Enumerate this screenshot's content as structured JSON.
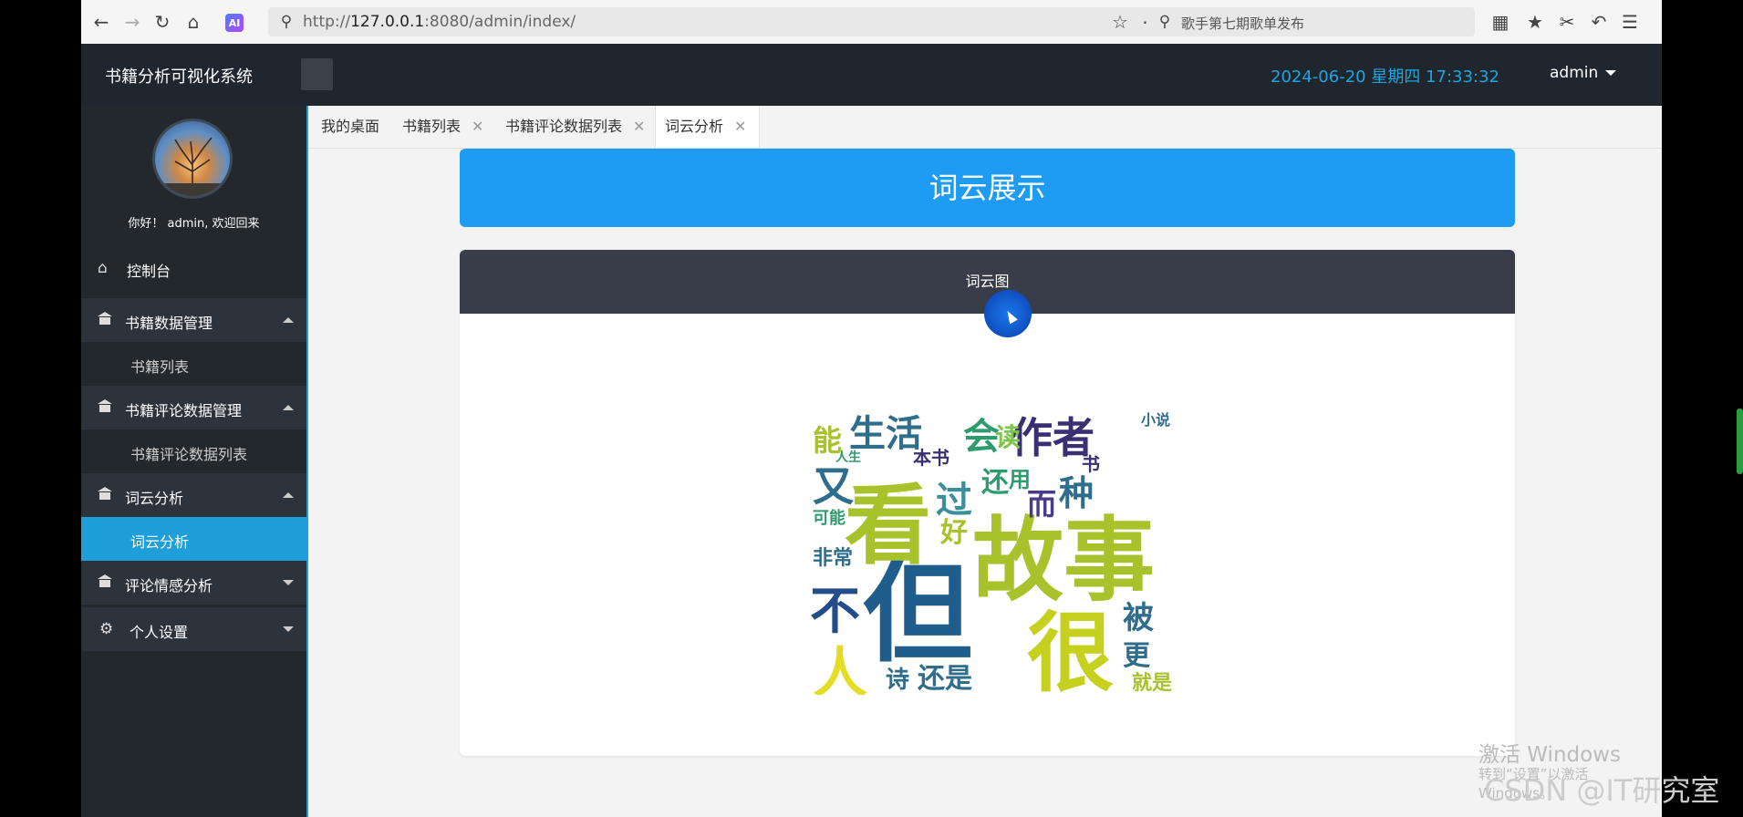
{
  "browser": {
    "url_prefix": "http://",
    "url_host": "127.0.0.1",
    "url_rest": ":8080/admin/index/",
    "search_placeholder": "歌手第七期歌单发布",
    "ai_label": "AI"
  },
  "header": {
    "brand": "书籍分析可视化系统",
    "datetime": "2024-06-20  星期四  17:33:32",
    "user": "admin"
  },
  "sidebar": {
    "welcome": "你好！ admin, 欢迎回来",
    "items": [
      {
        "label": "控制台",
        "icon": "home-icon"
      },
      {
        "label": "书籍数据管理",
        "icon": "bank-icon",
        "expanded": true
      },
      {
        "label": "书籍列表",
        "sub": true
      },
      {
        "label": "书籍评论数据管理",
        "icon": "bank-icon",
        "expanded": true
      },
      {
        "label": "书籍评论数据列表",
        "sub": true
      },
      {
        "label": "词云分析",
        "icon": "bank-icon",
        "expanded": true
      },
      {
        "label": "词云分析",
        "sub": true,
        "active": true
      },
      {
        "label": "评论情感分析",
        "icon": "bank-icon",
        "expanded": false
      },
      {
        "label": "个人设置",
        "icon": "gear-icon",
        "expanded": false
      }
    ]
  },
  "tabs": [
    {
      "label": "我的桌面",
      "closable": false
    },
    {
      "label": "书籍列表",
      "closable": true
    },
    {
      "label": "书籍评论数据列表",
      "closable": true
    },
    {
      "label": "词云分析",
      "closable": true,
      "active": true
    }
  ],
  "tab_close_glyph": "✕",
  "main": {
    "banner_title": "词云展示",
    "card_title": "词云图"
  },
  "wordcloud_words": [
    {
      "text": "故事",
      "color": "#a8c22c"
    },
    {
      "text": "但",
      "color": "#1f5e8c"
    },
    {
      "text": "看",
      "color": "#a8c22c"
    },
    {
      "text": "很",
      "color": "#c6d11f"
    },
    {
      "text": "人",
      "color": "#e3de23"
    },
    {
      "text": "不",
      "color": "#234c8a"
    },
    {
      "text": "作者",
      "color": "#3b2f73"
    },
    {
      "text": "生活",
      "color": "#2e6d8c"
    },
    {
      "text": "会",
      "color": "#2f9a6e"
    },
    {
      "text": "读",
      "color": "#7cc44a"
    },
    {
      "text": "能",
      "color": "#a8c22c"
    },
    {
      "text": "又",
      "color": "#2e6d8c"
    },
    {
      "text": "过",
      "color": "#3a8f9a"
    },
    {
      "text": "种",
      "color": "#2e6d8c"
    },
    {
      "text": "而",
      "color": "#4a3b86"
    },
    {
      "text": "小说",
      "color": "#2e6d8c"
    },
    {
      "text": "还是",
      "color": "#2e6d8c"
    },
    {
      "text": "被",
      "color": "#2e6d8c"
    },
    {
      "text": "更",
      "color": "#2e6d8c"
    },
    {
      "text": "就是",
      "color": "#a8c22c"
    },
    {
      "text": "诗",
      "color": "#2e6d8c"
    },
    {
      "text": "非常",
      "color": "#2e6d8c"
    },
    {
      "text": "可能",
      "color": "#2f9a6e"
    },
    {
      "text": "本书",
      "color": "#3b2f73"
    },
    {
      "text": "人生",
      "color": "#2f9a6e"
    },
    {
      "text": "好",
      "color": "#a8c22c"
    },
    {
      "text": "还",
      "color": "#2f9a6e"
    },
    {
      "text": "用",
      "color": "#2f9a6e"
    },
    {
      "text": "书",
      "color": "#3b2f73"
    }
  ],
  "watermark": {
    "line1": "激活 Windows",
    "line2": "转到“设置”以激活 Windows。",
    "csdn": "CSDN @IT研究室"
  }
}
